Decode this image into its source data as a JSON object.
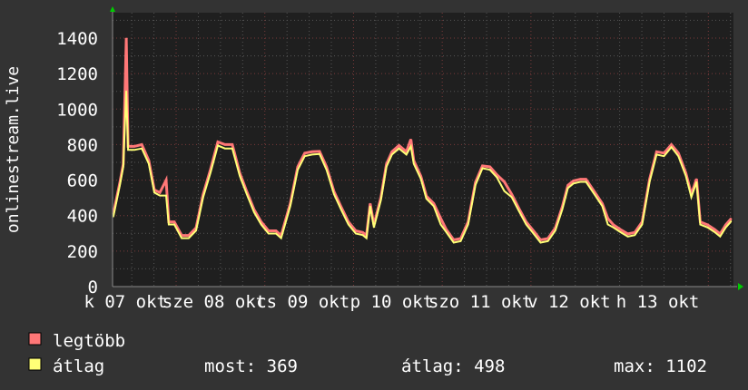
{
  "chart_data": {
    "type": "line",
    "ylabel": "onlinestream.live",
    "xlabel": "",
    "ylim": [
      0,
      1400
    ],
    "xlim_hours": [
      0,
      168
    ],
    "yticks": [
      "0",
      "200",
      "400",
      "600",
      "800",
      "1000",
      "1200",
      "1400"
    ],
    "ytick_values": [
      0,
      200,
      400,
      600,
      800,
      1000,
      1200,
      1400
    ],
    "xtick_labels": [
      "k 07 okt",
      "sze 08 okt",
      "cs 09 okt",
      "p 10 okt",
      "szo 11 okt",
      "v 12 okt",
      "h 13 okt"
    ],
    "xtick_label_hours": [
      3.5,
      27.5,
      51.5,
      75.5,
      99.5,
      123.5,
      147.5
    ],
    "day_boundaries_hours": [
      17.2,
      41.2,
      65.2,
      89.2,
      113.2,
      137.2,
      161.2
    ],
    "grid": true,
    "legend_placement": "bottom-left",
    "hours": [
      0.2,
      2.0,
      2.9,
      3.7,
      4.2,
      5.9,
      7.9,
      9.8,
      11.3,
      12.8,
      14.5,
      15.2,
      16.7,
      18.7,
      20.6,
      22.6,
      24.5,
      26.5,
      28.5,
      30.4,
      32.4,
      34.4,
      36.3,
      38.3,
      40.2,
      42.2,
      44.2,
      45.6,
      48.1,
      50.1,
      52.0,
      54.0,
      56.0,
      57.9,
      59.9,
      61.8,
      63.8,
      65.8,
      67.7,
      68.7,
      69.7,
      70.7,
      72.6,
      74.1,
      75.6,
      77.5,
      79.5,
      80.7,
      81.5,
      83.4,
      84.9,
      86.9,
      88.8,
      90.3,
      92.3,
      94.2,
      96.2,
      98.2,
      100.1,
      102.1,
      104.0,
      106.0,
      108.0,
      109.9,
      111.9,
      113.9,
      115.8,
      117.8,
      119.8,
      121.7,
      123.2,
      124.7,
      126.6,
      128.1,
      130.6,
      132.5,
      134.0,
      135.5,
      137.4,
      139.4,
      141.3,
      143.3,
      145.3,
      147.2,
      149.2,
      151.2,
      153.1,
      155.1,
      156.6,
      158.0,
      159.0,
      161.0,
      162.9,
      164.4,
      165.9,
      167.4
    ],
    "series": [
      {
        "name": "legtöbb",
        "color": "#ff7777",
        "values": [
          408,
          588,
          690,
          1400,
          790,
          790,
          800,
          710,
          545,
          530,
          600,
          365,
          365,
          288,
          288,
          331,
          520,
          660,
          815,
          800,
          800,
          640,
          536,
          434,
          365,
          314,
          314,
          288,
          468,
          675,
          752,
          760,
          762,
          675,
          536,
          451,
          365,
          314,
          305,
          288,
          468,
          348,
          502,
          690,
          760,
          795,
          760,
          830,
          710,
          622,
          510,
          468,
          384,
          322,
          263,
          271,
          365,
          588,
          680,
          675,
          630,
          590,
          520,
          442,
          365,
          314,
          263,
          271,
          331,
          451,
          570,
          596,
          605,
          605,
          528,
          468,
          384,
          348,
          322,
          297,
          305,
          365,
          605,
          760,
          752,
          800,
          752,
          640,
          520,
          607,
          365,
          348,
          322,
          297,
          348,
          384
        ]
      },
      {
        "name": "átlag",
        "color": "#ffff77",
        "values": [
          393,
          573,
          675,
          1102,
          770,
          770,
          778,
          692,
          530,
          513,
          513,
          350,
          350,
          273,
          273,
          316,
          504,
          641,
          795,
          778,
          778,
          624,
          521,
          419,
          350,
          299,
          299,
          273,
          453,
          658,
          735,
          744,
          747,
          658,
          521,
          436,
          350,
          299,
          290,
          273,
          453,
          333,
          487,
          675,
          744,
          778,
          744,
          790,
          692,
          607,
          495,
          453,
          350,
          307,
          248,
          256,
          350,
          573,
          667,
          658,
          615,
          538,
          504,
          427,
          350,
          299,
          248,
          256,
          316,
          436,
          555,
          581,
          590,
          590,
          513,
          453,
          350,
          333,
          307,
          282,
          290,
          350,
          590,
          744,
          735,
          786,
          735,
          624,
          504,
          590,
          350,
          333,
          307,
          282,
          333,
          369
        ]
      }
    ]
  },
  "legend": {
    "max_label": "legtöbb",
    "avg_label": "átlag",
    "most": "most: 369",
    "atlag": "átlag: 498",
    "max": "max: 1102"
  },
  "colors": {
    "background": "#333333",
    "plot": "#1f1f1f",
    "grid_minor": "#555555",
    "grid_major": "#7a3a3a",
    "arrow": "#00cc00"
  }
}
